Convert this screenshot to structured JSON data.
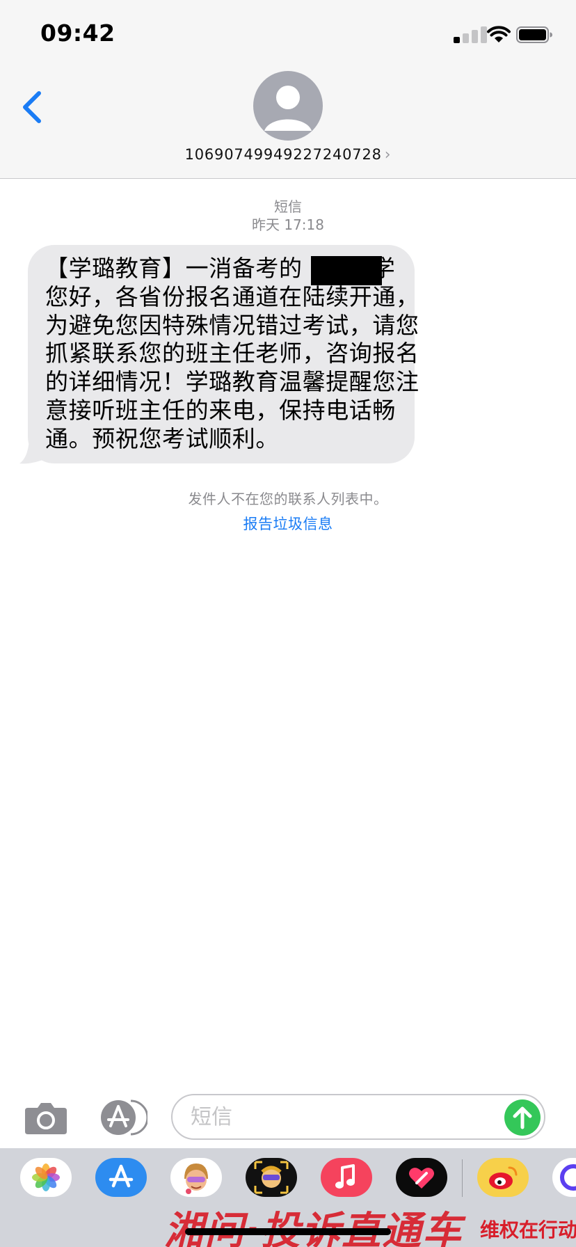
{
  "status_bar": {
    "time": "09:42",
    "signal_bars_active": 1,
    "signal_bars_total": 4
  },
  "header": {
    "contact": "10690749949227240728",
    "contact_chevron": "›",
    "back_icon": "chevron-left-icon",
    "avatar_icon": "person-icon"
  },
  "conversation": {
    "service": "短信",
    "timestamp": "昨天 17:18",
    "message": "【学璐教育】一消备考的      同学\n您好，各省份报名通道在陆续开通，\n为避免您因特殊情况错过考试，请您\n抓紧联系您的班主任老师，咨询报名\n的详细情况！学璐教育温馨提醒您注\n意接听班主任的来电，保持电话畅\n通。预祝您考试顺利。",
    "notice": "发件人不在您的联系人列表中。",
    "report_link": "报告垃圾信息"
  },
  "input_bar": {
    "placeholder": "短信",
    "camera_icon": "camera-icon",
    "apps_icon": "app-store-icon",
    "send_icon": "arrow-up-icon"
  },
  "app_drawer": {
    "apps": [
      "photos-icon",
      "app-store-icon",
      "memoji-icon",
      "animoji-icon",
      "music-icon",
      "digital-touch-icon",
      "weibo-icon",
      "more-app-icon"
    ],
    "watermark": "湘问·投诉直通车",
    "watermark_badge": "维权在行动"
  },
  "colors": {
    "link_blue": "#1a7cf5",
    "bubble_gray": "#e9e9eb",
    "send_green": "#34c759",
    "header_bg": "#f6f6f6",
    "watermark_red": "#d81e2a"
  }
}
